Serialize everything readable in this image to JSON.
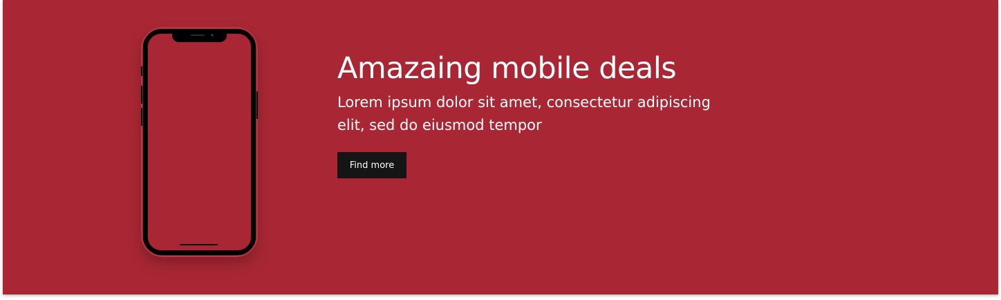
{
  "hero": {
    "title": "Amazaing mobile deals",
    "description": "Lorem ipsum dolor sit amet, consectetur adipiscing elit, sed do eiusmod tempor",
    "cta_label": "Find more",
    "image_icon": "smartphone-mockup-icon"
  },
  "colors": {
    "banner_background": "#a92734",
    "button_background": "#151515",
    "text": "#ffffff",
    "phone_frame": "#000000"
  }
}
